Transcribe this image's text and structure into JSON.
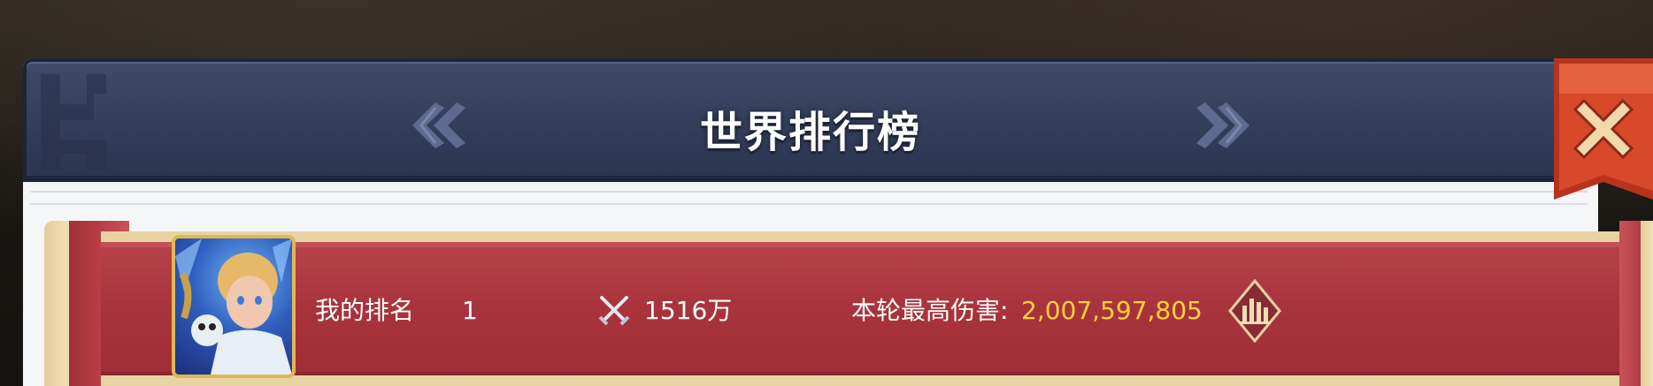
{
  "header": {
    "title": "世界排行榜",
    "prev_icon": "double-chevron-left-icon",
    "next_icon": "double-chevron-right-icon"
  },
  "close_button": {
    "icon": "close-icon",
    "color": "#d8492c"
  },
  "my_rank_row": {
    "rank_label": "我的排名",
    "rank_value": "1",
    "power_icon": "crossed-swords-icon",
    "power_value": "1516万",
    "damage_label": "本轮最高伤害:",
    "damage_value": "2,007,597,805",
    "damage_value_color": "#ffd23a",
    "stats_icon": "bar-chart-icon",
    "ribbon_color": "#a9333d"
  }
}
